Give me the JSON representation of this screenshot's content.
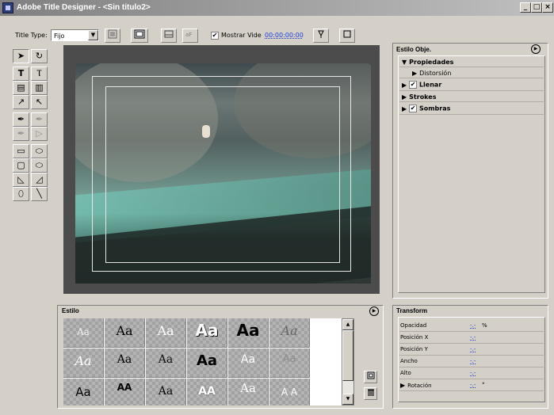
{
  "window": {
    "title": "Adobe Title Designer - <Sin titulo2>",
    "min": "_",
    "max": "□",
    "close": "×"
  },
  "toolbar": {
    "title_type_label": "Title Type:",
    "title_type_value": "Fijo",
    "show_video_label": "Mostrar Vide",
    "show_video_checked": "✔",
    "timecode": "00:00:00:00"
  },
  "estilo_obj": {
    "title": "Estilo Obje.",
    "props": {
      "propiedades": "Propiedades",
      "distorsion": "Distorsión",
      "llenar": "Llenar",
      "strokes": "Strokes",
      "sombras": "Sombras"
    },
    "checks": {
      "llenar": "✔",
      "sombras": "✔"
    }
  },
  "estilo": {
    "title": "Estilo",
    "swatches": [
      [
        "Aa",
        "Aa",
        "Aa",
        "Aa",
        "Aa",
        "Aa"
      ],
      [
        "Aa",
        "Aa",
        "Aa",
        "Aa",
        "Aa",
        "Aa"
      ],
      [
        "Aa",
        "AA",
        "Aa",
        "AA",
        "Aa",
        "A A"
      ]
    ]
  },
  "transform": {
    "title": "Transform",
    "opacidad": "Opacidad",
    "opacidad_val": "-.-",
    "opacidad_unit": "%",
    "posx": "Posición X",
    "posx_val": "-.-",
    "posy": "Posición Y",
    "posy_val": "-.-",
    "ancho": "Ancho",
    "ancho_val": "-.-",
    "alto": "Alto",
    "alto_val": "-.-",
    "rotacion": "Rotación",
    "rotacion_val": "-.-",
    "rotacion_unit": "°"
  }
}
